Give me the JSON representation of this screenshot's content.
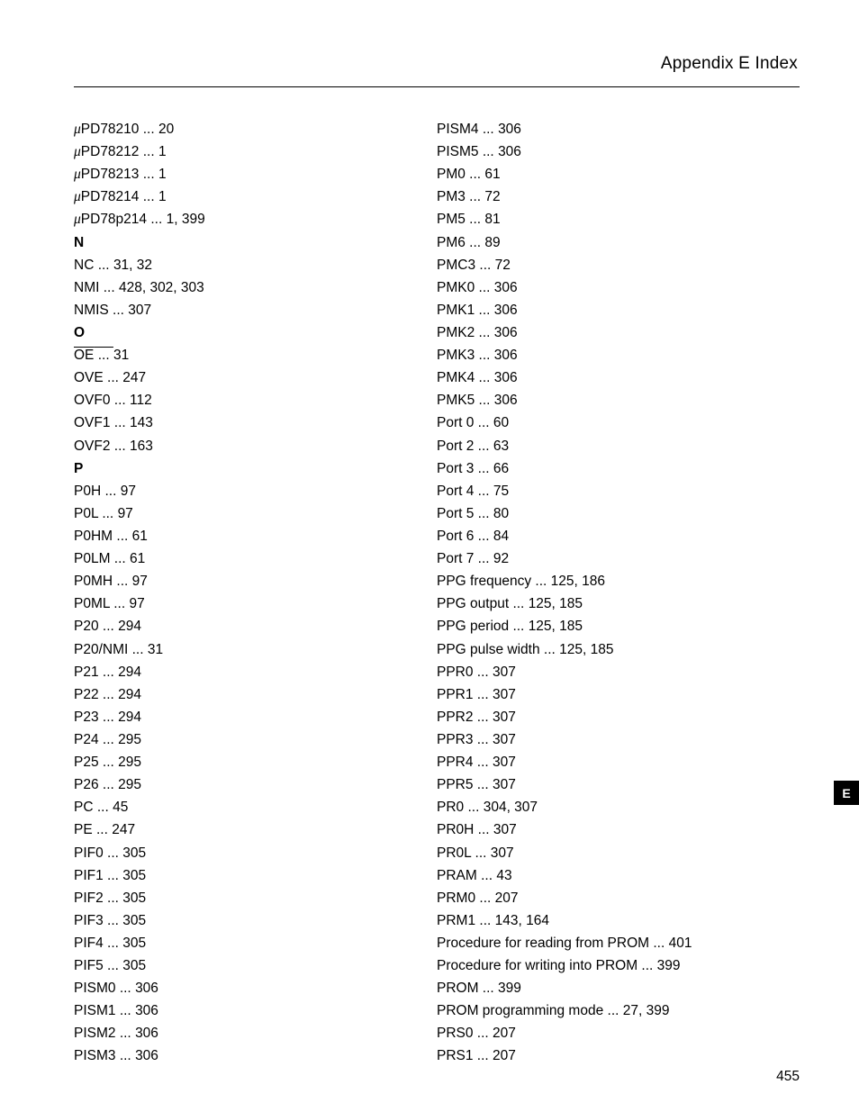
{
  "header": "Appendix E   Index",
  "left": [
    {
      "type": "entry",
      "prefix": "mu",
      "term": "PD78210",
      "pages": "20"
    },
    {
      "type": "entry",
      "prefix": "mu",
      "term": "PD78212",
      "pages": "1"
    },
    {
      "type": "entry",
      "prefix": "mu",
      "term": "PD78213",
      "pages": "1"
    },
    {
      "type": "entry",
      "prefix": "mu",
      "term": "PD78214",
      "pages": "1"
    },
    {
      "type": "entry",
      "prefix": "mu",
      "term": "PD78p214",
      "pages": "1, 399"
    },
    {
      "type": "heading",
      "term": "N"
    },
    {
      "type": "entry",
      "term": "NC",
      "pages": "31, 32"
    },
    {
      "type": "entry",
      "term": "NMI",
      "pages": "428, 302, 303"
    },
    {
      "type": "entry",
      "term": "NMIS",
      "pages": "307"
    },
    {
      "type": "heading",
      "term": "O"
    },
    {
      "type": "entry",
      "term": "OE",
      "style": "overbar",
      "pages": "31"
    },
    {
      "type": "entry",
      "term": "OVE",
      "pages": "247"
    },
    {
      "type": "entry",
      "term": "OVF0",
      "pages": "112"
    },
    {
      "type": "entry",
      "term": "OVF1",
      "pages": "143"
    },
    {
      "type": "entry",
      "term": "OVF2",
      "pages": "163"
    },
    {
      "type": "heading",
      "term": "P"
    },
    {
      "type": "entry",
      "term": "P0H",
      "pages": "97"
    },
    {
      "type": "entry",
      "term": "P0L",
      "pages": "97"
    },
    {
      "type": "entry",
      "term": "P0HM",
      "pages": "61"
    },
    {
      "type": "entry",
      "term": "P0LM",
      "pages": "61"
    },
    {
      "type": "entry",
      "term": "P0MH",
      "pages": "97"
    },
    {
      "type": "entry",
      "term": "P0ML",
      "pages": "97"
    },
    {
      "type": "entry",
      "term": "P20",
      "pages": "294"
    },
    {
      "type": "entry",
      "term": "P20/NMI",
      "pages": "31"
    },
    {
      "type": "entry",
      "term": "P21",
      "pages": "294"
    },
    {
      "type": "entry",
      "term": "P22",
      "pages": "294"
    },
    {
      "type": "entry",
      "term": "P23",
      "pages": "294"
    },
    {
      "type": "entry",
      "term": "P24",
      "pages": "295"
    },
    {
      "type": "entry",
      "term": "P25",
      "pages": "295"
    },
    {
      "type": "entry",
      "term": "P26",
      "pages": "295"
    },
    {
      "type": "entry",
      "term": "PC",
      "pages": "45"
    },
    {
      "type": "entry",
      "term": "PE",
      "pages": "247"
    },
    {
      "type": "entry",
      "term": "PIF0",
      "pages": "305"
    },
    {
      "type": "entry",
      "term": "PIF1",
      "pages": "305"
    },
    {
      "type": "entry",
      "term": "PIF2",
      "pages": "305"
    },
    {
      "type": "entry",
      "term": "PIF3",
      "pages": "305"
    },
    {
      "type": "entry",
      "term": "PIF4",
      "pages": "305"
    },
    {
      "type": "entry",
      "term": "PIF5",
      "pages": "305"
    },
    {
      "type": "entry",
      "term": "PISM0",
      "pages": "306"
    },
    {
      "type": "entry",
      "term": "PISM1",
      "pages": "306"
    },
    {
      "type": "entry",
      "term": "PISM2",
      "pages": "306"
    },
    {
      "type": "entry",
      "term": "PISM3",
      "pages": "306"
    }
  ],
  "right": [
    {
      "type": "entry",
      "term": "PISM4",
      "pages": "306"
    },
    {
      "type": "entry",
      "term": "PISM5",
      "pages": "306"
    },
    {
      "type": "entry",
      "term": "PM0",
      "pages": "61"
    },
    {
      "type": "entry",
      "term": "PM3",
      "pages": "72"
    },
    {
      "type": "entry",
      "term": "PM5",
      "pages": "81"
    },
    {
      "type": "entry",
      "term": "PM6",
      "pages": "89"
    },
    {
      "type": "entry",
      "term": "PMC3",
      "pages": "72"
    },
    {
      "type": "entry",
      "term": "PMK0",
      "pages": "306"
    },
    {
      "type": "entry",
      "term": "PMK1",
      "pages": "306"
    },
    {
      "type": "entry",
      "term": "PMK2",
      "pages": "306"
    },
    {
      "type": "entry",
      "term": "PMK3",
      "pages": "306"
    },
    {
      "type": "entry",
      "term": "PMK4",
      "pages": "306"
    },
    {
      "type": "entry",
      "term": "PMK5",
      "pages": "306"
    },
    {
      "type": "entry",
      "term": "Port 0",
      "pages": "60"
    },
    {
      "type": "entry",
      "term": "Port 2",
      "pages": "63"
    },
    {
      "type": "entry",
      "term": "Port 3",
      "pages": "66"
    },
    {
      "type": "entry",
      "term": "Port 4",
      "pages": "75"
    },
    {
      "type": "entry",
      "term": "Port 5",
      "pages": "80"
    },
    {
      "type": "entry",
      "term": "Port 6",
      "pages": "84"
    },
    {
      "type": "entry",
      "term": "Port 7",
      "pages": "92"
    },
    {
      "type": "entry",
      "term": "PPG frequency",
      "pages": "125, 186"
    },
    {
      "type": "entry",
      "term": "PPG output",
      "pages": "125, 185"
    },
    {
      "type": "entry",
      "term": "PPG period",
      "pages": "125, 185"
    },
    {
      "type": "entry",
      "term": "PPG pulse width",
      "pages": "125, 185"
    },
    {
      "type": "entry",
      "term": "PPR0",
      "pages": "307"
    },
    {
      "type": "entry",
      "term": "PPR1",
      "pages": "307"
    },
    {
      "type": "entry",
      "term": "PPR2",
      "pages": "307"
    },
    {
      "type": "entry",
      "term": "PPR3",
      "pages": "307"
    },
    {
      "type": "entry",
      "term": "PPR4",
      "pages": "307"
    },
    {
      "type": "entry",
      "term": "PPR5",
      "pages": "307"
    },
    {
      "type": "entry",
      "term": "PR0",
      "pages": "304, 307"
    },
    {
      "type": "entry",
      "term": "PR0H",
      "pages": "307"
    },
    {
      "type": "entry",
      "term": "PR0L",
      "pages": "307"
    },
    {
      "type": "entry",
      "term": "PRAM",
      "pages": "43"
    },
    {
      "type": "entry",
      "term": "PRM0",
      "pages": "207"
    },
    {
      "type": "entry",
      "term": "PRM1",
      "pages": "143, 164"
    },
    {
      "type": "entry",
      "term": "Procedure for reading from PROM",
      "pages": "401"
    },
    {
      "type": "entry",
      "term": "Procedure for writing into PROM",
      "pages": "399"
    },
    {
      "type": "entry",
      "term": "PROM",
      "pages": "399"
    },
    {
      "type": "entry",
      "term": "PROM programming mode",
      "pages": "27, 399"
    },
    {
      "type": "entry",
      "term": "PRS0",
      "pages": "207"
    },
    {
      "type": "entry",
      "term": "PRS1",
      "pages": "207"
    }
  ],
  "pagenum": "455",
  "sidetab": "E"
}
